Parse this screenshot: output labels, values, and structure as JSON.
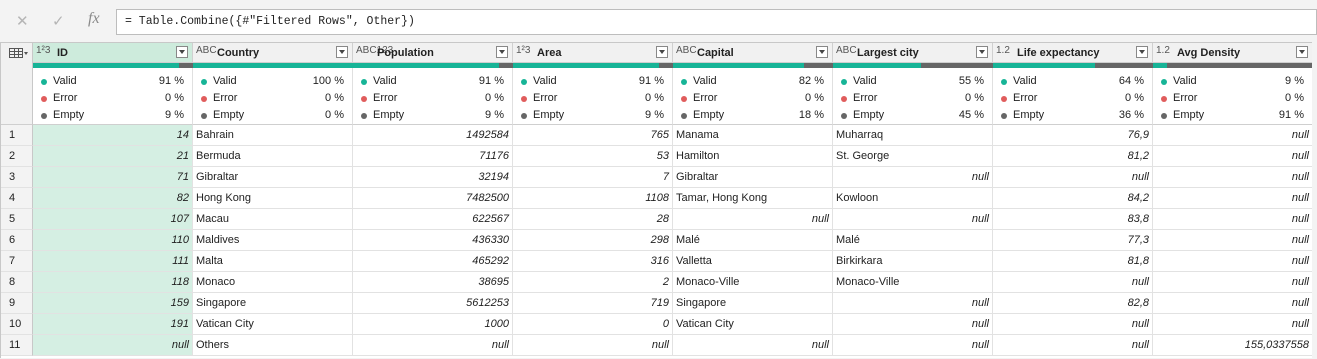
{
  "formula_bar": {
    "cancel_icon": "close-icon",
    "commit_icon": "check-icon",
    "fx_label": "fx",
    "formula": "= Table.Combine({#\"Filtered Rows\", Other})"
  },
  "quality_labels": {
    "valid": "Valid",
    "error": "Error",
    "empty": "Empty"
  },
  "colors": {
    "valid": "#17b497",
    "error": "#e05c5c",
    "empty": "#666666",
    "selected_column": "#d5efe3"
  },
  "columns": [
    {
      "name": "ID",
      "type_icon": "1²3",
      "valid": "91 %",
      "error": "0 %",
      "empty": "9 %",
      "valid_frac": 0.91,
      "error_frac": 0,
      "empty_frac": 0.09
    },
    {
      "name": "Country",
      "type_icon": "ABC",
      "valid": "100 %",
      "error": "0 %",
      "empty": "0 %",
      "valid_frac": 1.0,
      "error_frac": 0,
      "empty_frac": 0
    },
    {
      "name": "Population",
      "type_icon": "ABC123",
      "valid": "91 %",
      "error": "0 %",
      "empty": "9 %",
      "valid_frac": 0.91,
      "error_frac": 0,
      "empty_frac": 0.09
    },
    {
      "name": "Area",
      "type_icon": "1²3",
      "valid": "91 %",
      "error": "0 %",
      "empty": "9 %",
      "valid_frac": 0.91,
      "error_frac": 0,
      "empty_frac": 0.09
    },
    {
      "name": "Capital",
      "type_icon": "ABC",
      "valid": "82 %",
      "error": "0 %",
      "empty": "18 %",
      "valid_frac": 0.82,
      "error_frac": 0,
      "empty_frac": 0.18
    },
    {
      "name": "Largest city",
      "type_icon": "ABC",
      "valid": "55 %",
      "error": "0 %",
      "empty": "45 %",
      "valid_frac": 0.55,
      "error_frac": 0,
      "empty_frac": 0.45
    },
    {
      "name": "Life expectancy",
      "type_icon": "1.2",
      "valid": "64 %",
      "error": "0 %",
      "empty": "36 %",
      "valid_frac": 0.64,
      "error_frac": 0,
      "empty_frac": 0.36
    },
    {
      "name": "Avg Density",
      "type_icon": "1.2",
      "valid": "9 %",
      "error": "0 %",
      "empty": "91 %",
      "valid_frac": 0.09,
      "error_frac": 0,
      "empty_frac": 0.91
    }
  ],
  "rows": [
    [
      "1",
      "14",
      "Bahrain",
      "1492584",
      "765",
      "Manama",
      "Muharraq",
      "76,9",
      "null"
    ],
    [
      "2",
      "21",
      "Bermuda",
      "71176",
      "53",
      "Hamilton",
      "St. George",
      "81,2",
      "null"
    ],
    [
      "3",
      "71",
      "Gibraltar",
      "32194",
      "7",
      "Gibraltar",
      "null",
      "null",
      "null"
    ],
    [
      "4",
      "82",
      "Hong Kong",
      "7482500",
      "1108",
      "Tamar, Hong Kong",
      "Kowloon",
      "84,2",
      "null"
    ],
    [
      "5",
      "107",
      "Macau",
      "622567",
      "28",
      "null",
      "null",
      "83,8",
      "null"
    ],
    [
      "6",
      "110",
      "Maldives",
      "436330",
      "298",
      "Malé",
      "Malé",
      "77,3",
      "null"
    ],
    [
      "7",
      "111",
      "Malta",
      "465292",
      "316",
      "Valletta",
      "Birkirkara",
      "81,8",
      "null"
    ],
    [
      "8",
      "118",
      "Monaco",
      "38695",
      "2",
      "Monaco-Ville",
      "Monaco-Ville",
      "null",
      "null"
    ],
    [
      "9",
      "159",
      "Singapore",
      "5612253",
      "719",
      "Singapore",
      "null",
      "82,8",
      "null"
    ],
    [
      "10",
      "191",
      "Vatican City",
      "1000",
      "0",
      "Vatican City",
      "null",
      "null",
      "null"
    ],
    [
      "11",
      "null",
      "Others",
      "null",
      "null",
      "null",
      "null",
      "null",
      "155,0337558"
    ]
  ]
}
